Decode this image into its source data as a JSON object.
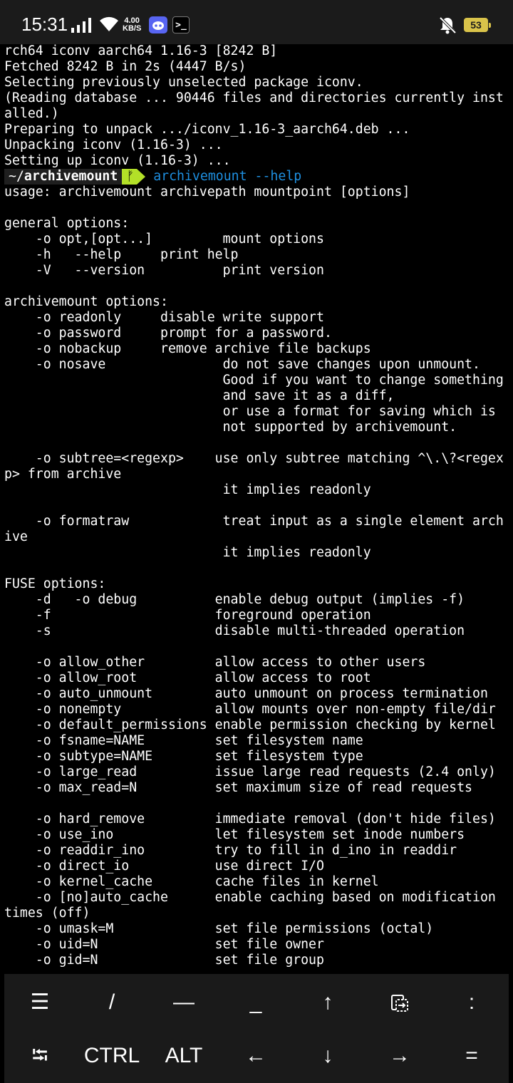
{
  "status_bar": {
    "time": "15:31",
    "speed": "4.00",
    "speed_unit": "KB/S",
    "battery": "53"
  },
  "terminal": {
    "lines": [
      "rch64 iconv aarch64 1.16-3 [8242 B]",
      "Fetched 8242 B in 2s (4447 B/s)",
      "Selecting previously unselected package iconv.",
      "(Reading database ... 90446 files and directories currently inst",
      "alled.)",
      "Preparing to unpack .../iconv_1.16-3_aarch64.deb ...",
      "Unpacking iconv (1.16-3) ...",
      "Setting up iconv (1.16-3) ..."
    ],
    "prompt": {
      "dir_prefix": "~/",
      "dir_name": "archivemount",
      "git_symbol": "ᚠ",
      "command": "archivemount --help"
    },
    "output": [
      "usage: archivemount archivepath mountpoint [options]",
      "",
      "general options:",
      "    -o opt,[opt...]         mount options",
      "    -h   --help     print help",
      "    -V   --version          print version",
      "",
      "archivemount options:",
      "    -o readonly     disable write support",
      "    -o password     prompt for a password.",
      "    -o nobackup     remove archive file backups",
      "    -o nosave               do not save changes upon unmount.",
      "                            Good if you want to change something",
      "                            and save it as a diff,",
      "                            or use a format for saving which is",
      "                            not supported by archivemount.",
      "",
      "    -o subtree=<regexp>    use only subtree matching ^\\.\\?<regex",
      "p> from archive",
      "                            it implies readonly",
      "",
      "    -o formatraw            treat input as a single element arch",
      "ive",
      "                            it implies readonly",
      "",
      "FUSE options:",
      "    -d   -o debug          enable debug output (implies -f)",
      "    -f                     foreground operation",
      "    -s                     disable multi-threaded operation",
      "",
      "    -o allow_other         allow access to other users",
      "    -o allow_root          allow access to root",
      "    -o auto_unmount        auto unmount on process termination",
      "    -o nonempty            allow mounts over non-empty file/dir",
      "    -o default_permissions enable permission checking by kernel",
      "    -o fsname=NAME         set filesystem name",
      "    -o subtype=NAME        set filesystem type",
      "    -o large_read          issue large read requests (2.4 only)",
      "    -o max_read=N          set maximum size of read requests",
      "",
      "    -o hard_remove         immediate removal (don't hide files)",
      "    -o use_ino             let filesystem set inode numbers",
      "    -o readdir_ino         try to fill in d_ino in readdir",
      "    -o direct_io           use direct I/O",
      "    -o kernel_cache        cache files in kernel",
      "    -o [no]auto_cache      enable caching based on modification",
      "times (off)",
      "    -o umask=M             set file permissions (octal)",
      "    -o uid=N               set file owner",
      "    -o gid=N               set file group"
    ]
  },
  "extra_keys": {
    "row1": [
      {
        "name": "drawer-key",
        "label": "☰",
        "icon": "menu-icon"
      },
      {
        "name": "slash-key",
        "label": "/"
      },
      {
        "name": "dash-key",
        "label": "—"
      },
      {
        "name": "underscore-key",
        "label": "_"
      },
      {
        "name": "up-key",
        "label": "↑",
        "icon": "arrow-up-icon"
      },
      {
        "name": "paste-key",
        "label": "",
        "icon": "paste-icon"
      },
      {
        "name": "colon-key",
        "label": ":"
      }
    ],
    "row2": [
      {
        "name": "tab-key",
        "label": "⭾",
        "icon": "tab-icon"
      },
      {
        "name": "ctrl-key",
        "label": "CTRL"
      },
      {
        "name": "alt-key",
        "label": "ALT"
      },
      {
        "name": "left-key",
        "label": "←",
        "icon": "arrow-left-icon"
      },
      {
        "name": "down-key",
        "label": "↓",
        "icon": "arrow-down-icon"
      },
      {
        "name": "right-key",
        "label": "→",
        "icon": "arrow-right-icon"
      },
      {
        "name": "equals-key",
        "label": "="
      }
    ]
  },
  "colors": {
    "prompt_accent": "#b3e028",
    "command": "#1e8fe0",
    "background": "#000000",
    "keys_background": "#1a1a1a"
  }
}
